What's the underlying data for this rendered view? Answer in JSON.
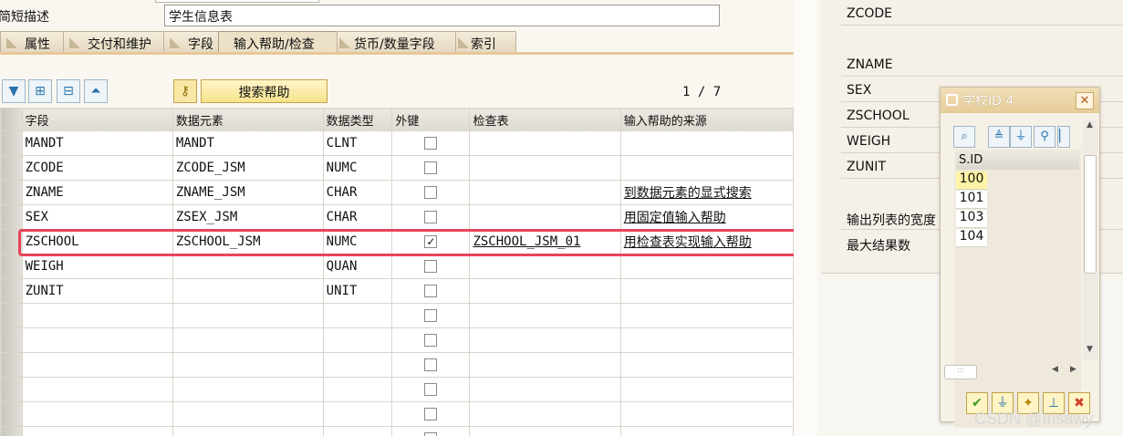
{
  "header": {
    "desc_label": "简短描述",
    "desc_value": "学生信息表"
  },
  "tabs": [
    {
      "label": "属性"
    },
    {
      "label": "交付和维护"
    },
    {
      "label": "字段"
    },
    {
      "label": "输入帮助/检查"
    },
    {
      "label": "货币/数量字段"
    },
    {
      "label": "索引"
    }
  ],
  "toolbar": {
    "search_help_label": "搜索帮助",
    "page_counter": "1 / 7"
  },
  "grid": {
    "headers": [
      "字段",
      "数据元素",
      "数据类型",
      "外键",
      "检查表",
      "输入帮助的来源"
    ],
    "rows": [
      {
        "field": "MANDT",
        "element": "MANDT",
        "type": "CLNT",
        "fk": false,
        "check": "",
        "help": ""
      },
      {
        "field": "ZCODE",
        "element": "ZCODE_JSM",
        "type": "NUMC",
        "fk": false,
        "check": "",
        "help": ""
      },
      {
        "field": "ZNAME",
        "element": "ZNAME_JSM",
        "type": "CHAR",
        "fk": false,
        "check": "",
        "help": "到数据元素的显式搜索"
      },
      {
        "field": "SEX",
        "element": "ZSEX_JSM",
        "type": "CHAR",
        "fk": false,
        "check": "",
        "help": "用固定值输入帮助"
      },
      {
        "field": "ZSCHOOL",
        "element": "ZSCHOOL_JSM",
        "type": "NUMC",
        "fk": true,
        "check": "ZSCHOOL_JSM_01",
        "help": "用检查表实现输入帮助"
      },
      {
        "field": "WEIGH",
        "element": "",
        "type": "QUAN",
        "fk": false,
        "check": "",
        "help": ""
      },
      {
        "field": "ZUNIT",
        "element": "",
        "type": "UNIT",
        "fk": false,
        "check": "",
        "help": ""
      }
    ],
    "empty_rows": 6
  },
  "right_panel": {
    "labels": [
      "ZCODE",
      "ZNAME",
      "SEX",
      "ZSCHOOL",
      "WEIGH",
      "ZUNIT",
      "输出列表的宽度",
      "最大结果数"
    ]
  },
  "popup": {
    "title": "学校ID 4 ...",
    "column_header": "S.ID",
    "ids": [
      "100",
      "101",
      "103",
      "104"
    ]
  },
  "watermark": "CSDN @Irisawy",
  "colors": {
    "highlight": "#e8445a",
    "selected_id": "#fff3a6"
  }
}
